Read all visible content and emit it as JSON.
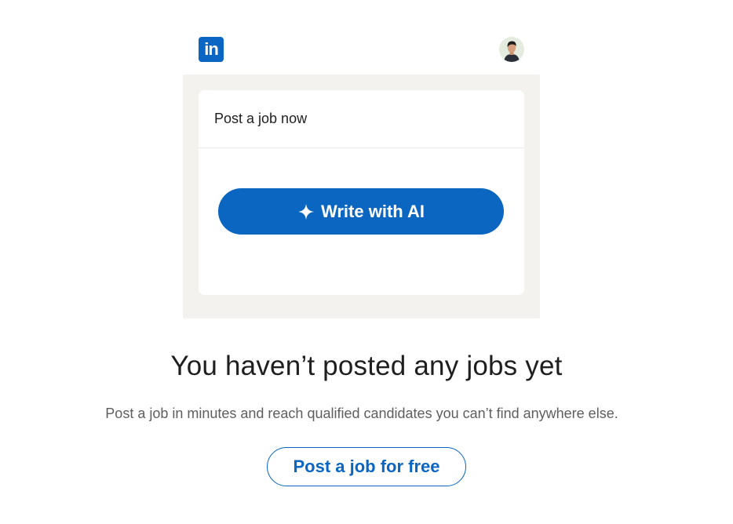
{
  "header": {
    "logo_text": "in",
    "logo_icon": "linkedin-logo",
    "avatar_icon": "user-avatar"
  },
  "illustration": {
    "card_title": "Post a job now",
    "ai_button_label": "Write with AI",
    "ai_button_icon": "sparkle-icon"
  },
  "empty_state": {
    "headline": "You haven’t posted any jobs yet",
    "description": "Post a job in minutes and reach qualified candidates you can’t find anywhere else.",
    "cta_label": "Post a job for free"
  },
  "colors": {
    "brand_blue": "#0a66c2",
    "button_blue": "#0b66c2",
    "link_blue": "#0a66c2",
    "background_gray": "#f3f2ef",
    "text_dark": "#1f1f1f",
    "text_muted": "#5e5e5e"
  }
}
